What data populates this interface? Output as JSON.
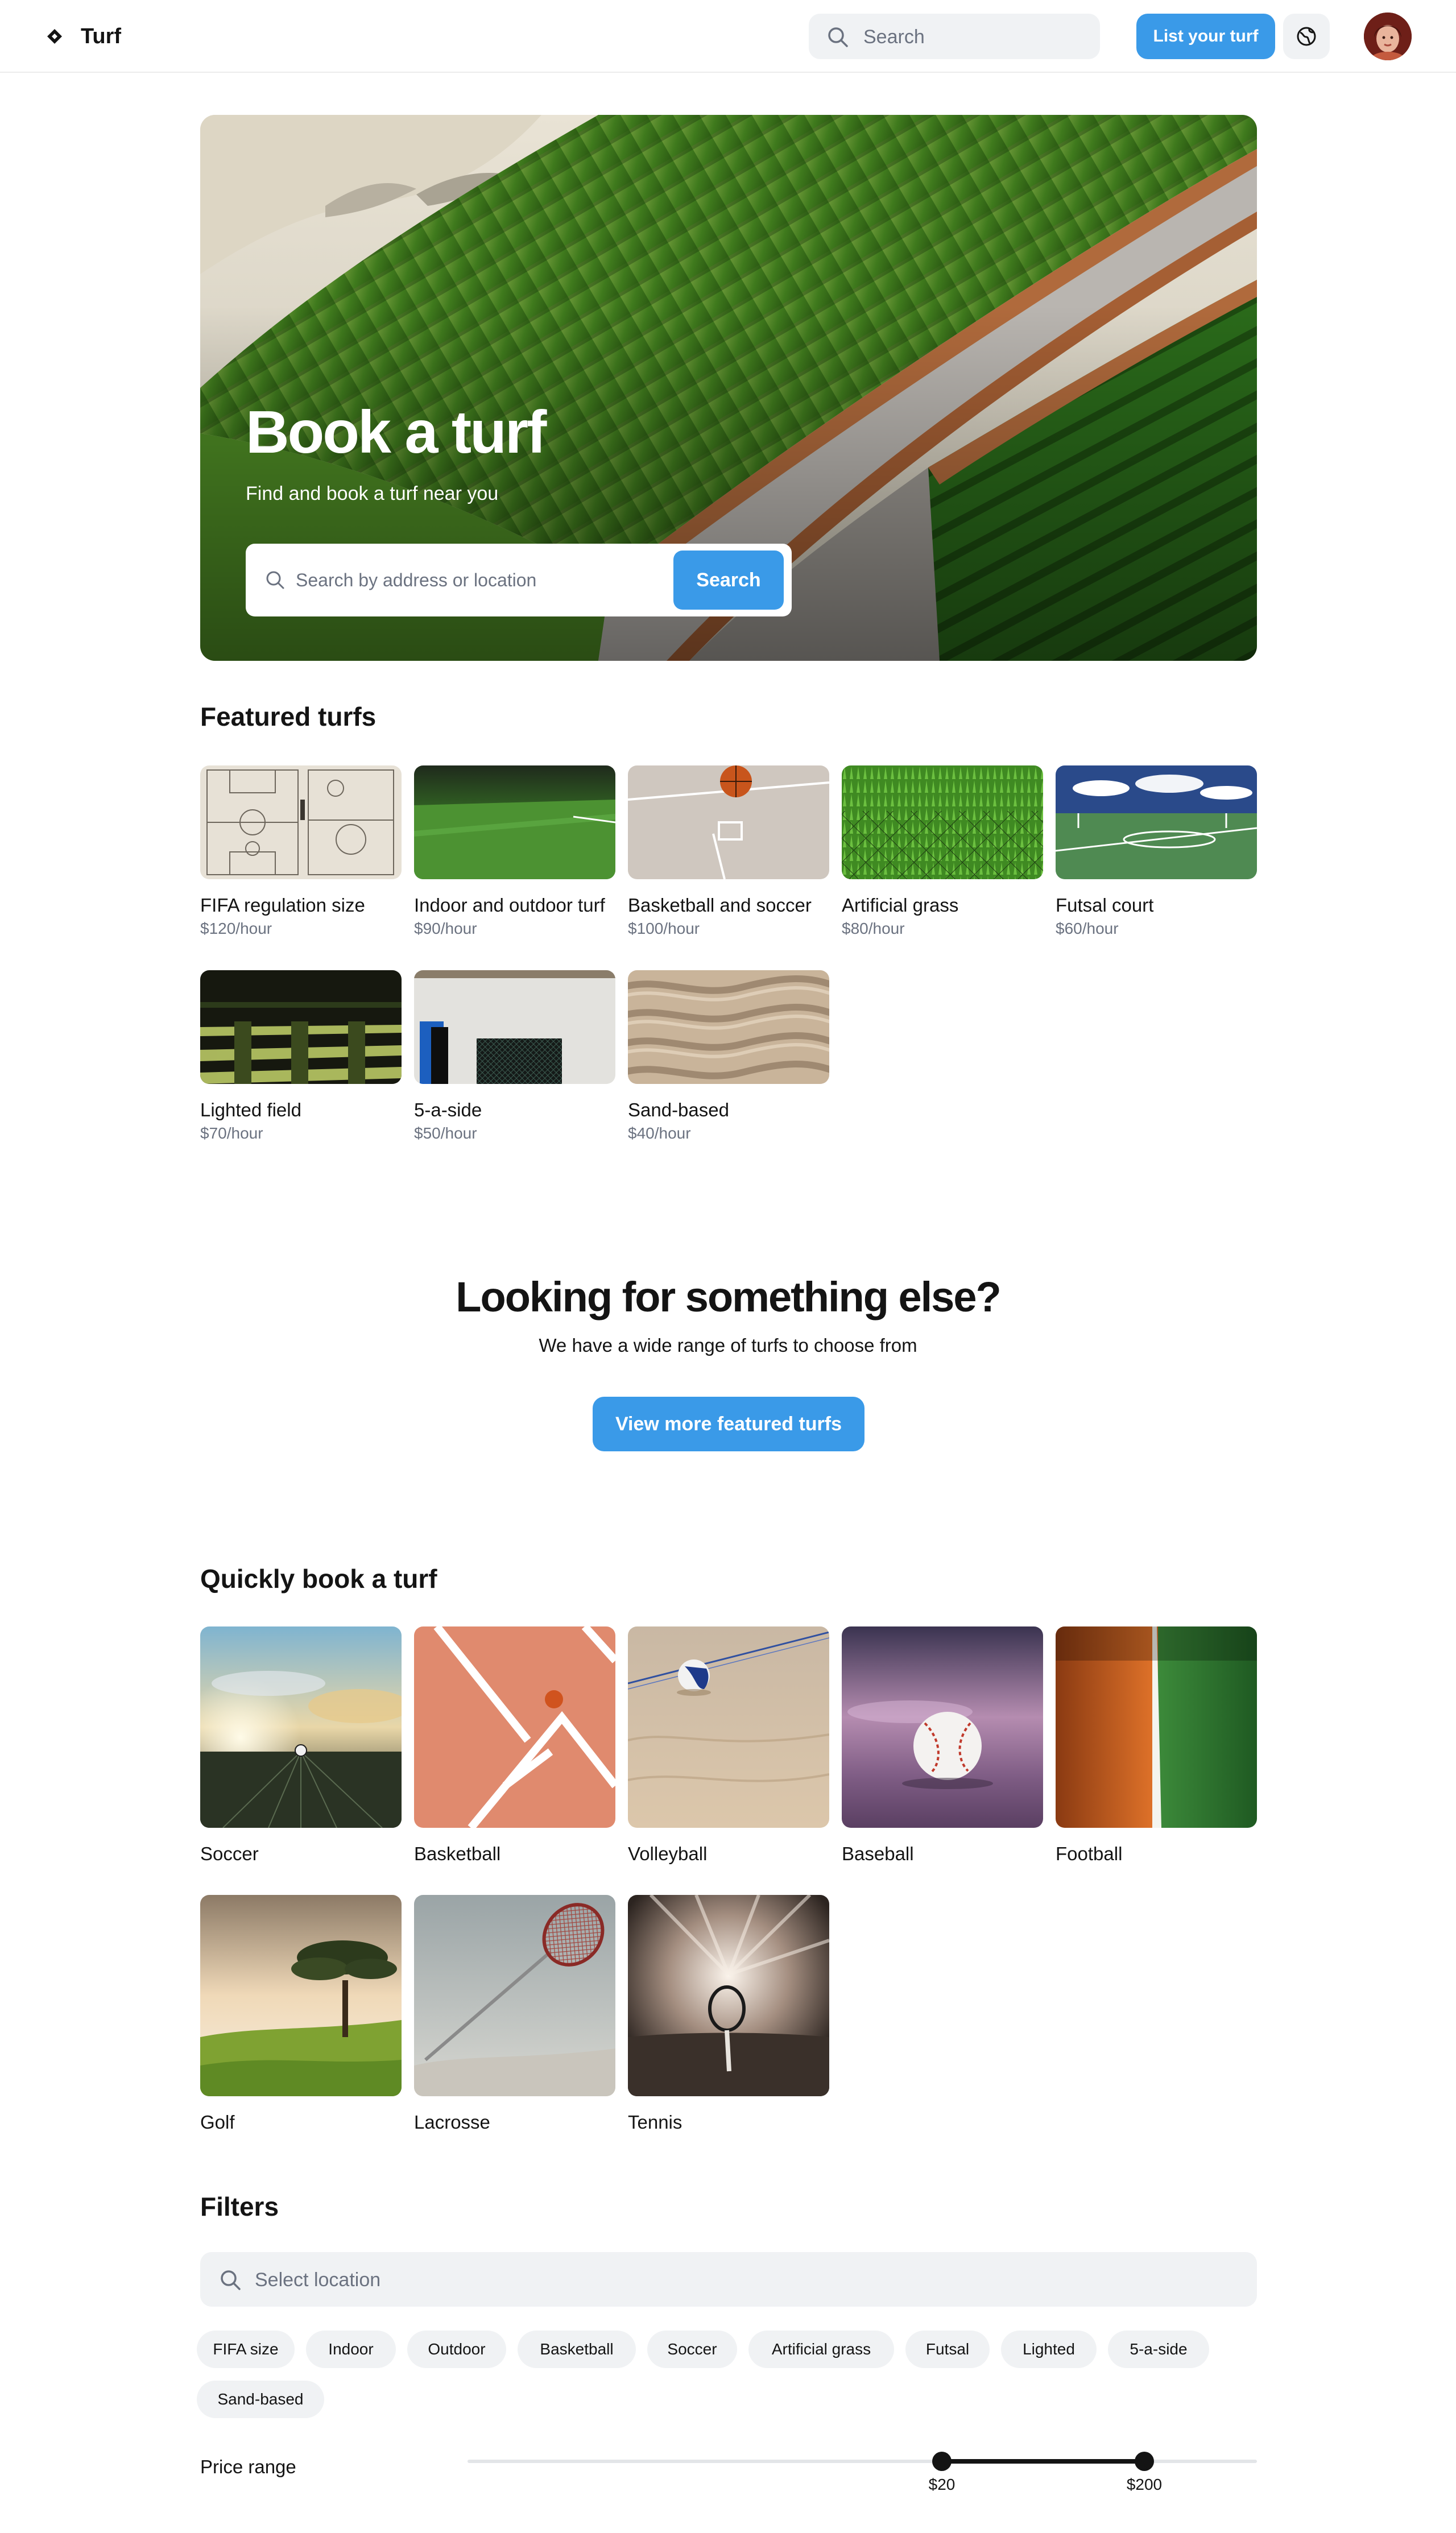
{
  "header": {
    "brand": "Turf",
    "search_placeholder": "Search",
    "list_button": "List your turf",
    "icons": [
      "diamond-logo-icon",
      "search-icon",
      "globe-icon",
      "avatar"
    ]
  },
  "hero": {
    "title": "Book a turf",
    "subtitle": "Find and book a turf near you",
    "search_placeholder": "Search by address or location",
    "search_button": "Search"
  },
  "featured": {
    "title": "Featured turfs",
    "items": [
      {
        "name": "FIFA regulation size",
        "price": "$120/hour"
      },
      {
        "name": "Indoor and outdoor turf",
        "price": "$90/hour"
      },
      {
        "name": "Basketball and soccer",
        "price": "$100/hour"
      },
      {
        "name": "Artificial grass",
        "price": "$80/hour"
      },
      {
        "name": "Futsal court",
        "price": "$60/hour"
      },
      {
        "name": "Lighted field",
        "price": "$70/hour"
      },
      {
        "name": "5-a-side",
        "price": "$50/hour"
      },
      {
        "name": "Sand-based",
        "price": "$40/hour"
      }
    ]
  },
  "cta": {
    "title": "Looking for something else?",
    "subtitle": "We have a wide range of turfs to choose from",
    "button": "View more featured turfs"
  },
  "quick": {
    "title": "Quickly book a turf",
    "items": [
      "Soccer",
      "Basketball",
      "Volleyball",
      "Baseball",
      "Football",
      "Golf",
      "Lacrosse",
      "Tennis"
    ]
  },
  "filters": {
    "title": "Filters",
    "location_placeholder": "Select location",
    "chips": [
      "FIFA size",
      "Indoor",
      "Outdoor",
      "Basketball",
      "Soccer",
      "Artificial grass",
      "Futsal",
      "Lighted",
      "5-a-side",
      "Sand-based"
    ],
    "price_label": "Price range",
    "price_min": "$20",
    "price_max": "$200"
  },
  "colors": {
    "accent": "#3a9ae8",
    "text": "#141414",
    "muted": "#6b7280",
    "surface": "#f0f2f4"
  }
}
